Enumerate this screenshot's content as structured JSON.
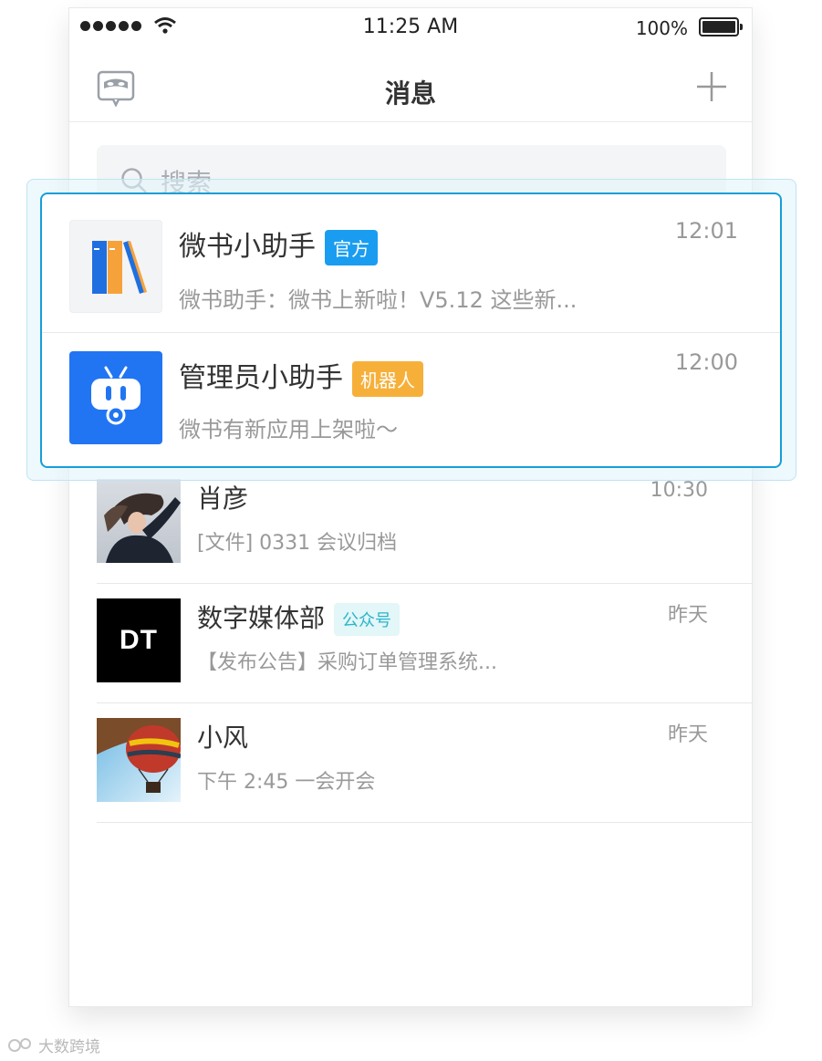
{
  "status_bar": {
    "time": "11:25 AM",
    "battery": "100%"
  },
  "nav": {
    "title": "消息"
  },
  "search": {
    "placeholder": "搜索"
  },
  "highlight_items": [
    {
      "name": "微书小助手",
      "tag": "官方",
      "message": "微书助手：微书上新啦！V5.12 这些新...",
      "time": "12:01"
    },
    {
      "name": "管理员小助手",
      "tag": "机器人",
      "message": "微书有新应用上架啦～",
      "time": "12:00"
    }
  ],
  "list_items": [
    {
      "name": "肖彦",
      "message": "[文件] 0331 会议归档",
      "time": "10:30"
    },
    {
      "name": "数字媒体部",
      "tag": "公众号",
      "avatar_text": "DT",
      "message": "【发布公告】采购订单管理系统...",
      "time": "昨天"
    },
    {
      "name": "小风",
      "message": "下午 2:45 一会开会",
      "time": "昨天"
    }
  ],
  "colors": {
    "accent": "#169ed9",
    "tag_official": "#1a9df0",
    "tag_robot": "#f6b03a",
    "tag_public": "#e3f6f8",
    "robot_avatar": "#2275f2"
  },
  "watermark": "大数跨境"
}
